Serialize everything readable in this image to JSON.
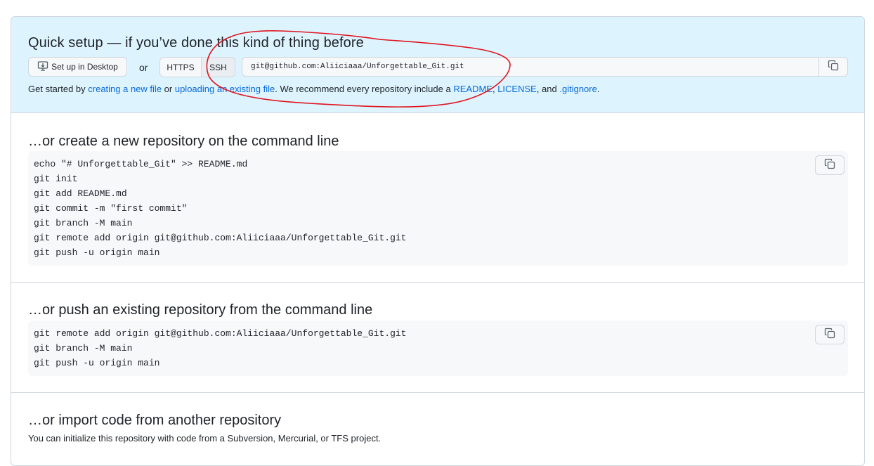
{
  "quick_setup": {
    "title": "Quick setup — if you’ve done this kind of thing before",
    "desktop_button": "Set up in Desktop",
    "or_label": "or",
    "https_label": "HTTPS",
    "ssh_label": "SSH",
    "url_value": "git@github.com:Aliiciaaa/Unforgettable_Git.git",
    "get_started": {
      "prefix": "Get started by ",
      "link_new_file": "creating a new file",
      "mid1": " or ",
      "link_upload": "uploading an existing file",
      "mid2": ". We recommend every repository include a ",
      "link_readme": "README",
      "comma1": ", ",
      "link_license": "LICENSE",
      "mid3": ", and ",
      "link_gitignore": ".gitignore",
      "suffix": "."
    }
  },
  "create_section": {
    "title": "…or create a new repository on the command line",
    "lines": [
      "echo \"# Unforgettable_Git\" >> README.md",
      "git init",
      "git add README.md",
      "git commit -m \"first commit\"",
      "git branch -M main",
      "git remote add origin git@github.com:Aliiciaaa/Unforgettable_Git.git",
      "git push -u origin main"
    ]
  },
  "push_section": {
    "title": "…or push an existing repository from the command line",
    "lines": [
      "git remote add origin git@github.com:Aliiciaaa/Unforgettable_Git.git",
      "git branch -M main",
      "git push -u origin main"
    ]
  },
  "import_section": {
    "title": "…or import code from another repository",
    "description": "You can initialize this repository with code from a Subversion, Mercurial, or TFS project."
  },
  "icons": {
    "desktop": "desktop-download-icon",
    "copy": "copy-icon"
  },
  "colors": {
    "quick_bg": "#ddf4ff",
    "link": "#0969da",
    "annotation": "#e0141e"
  }
}
